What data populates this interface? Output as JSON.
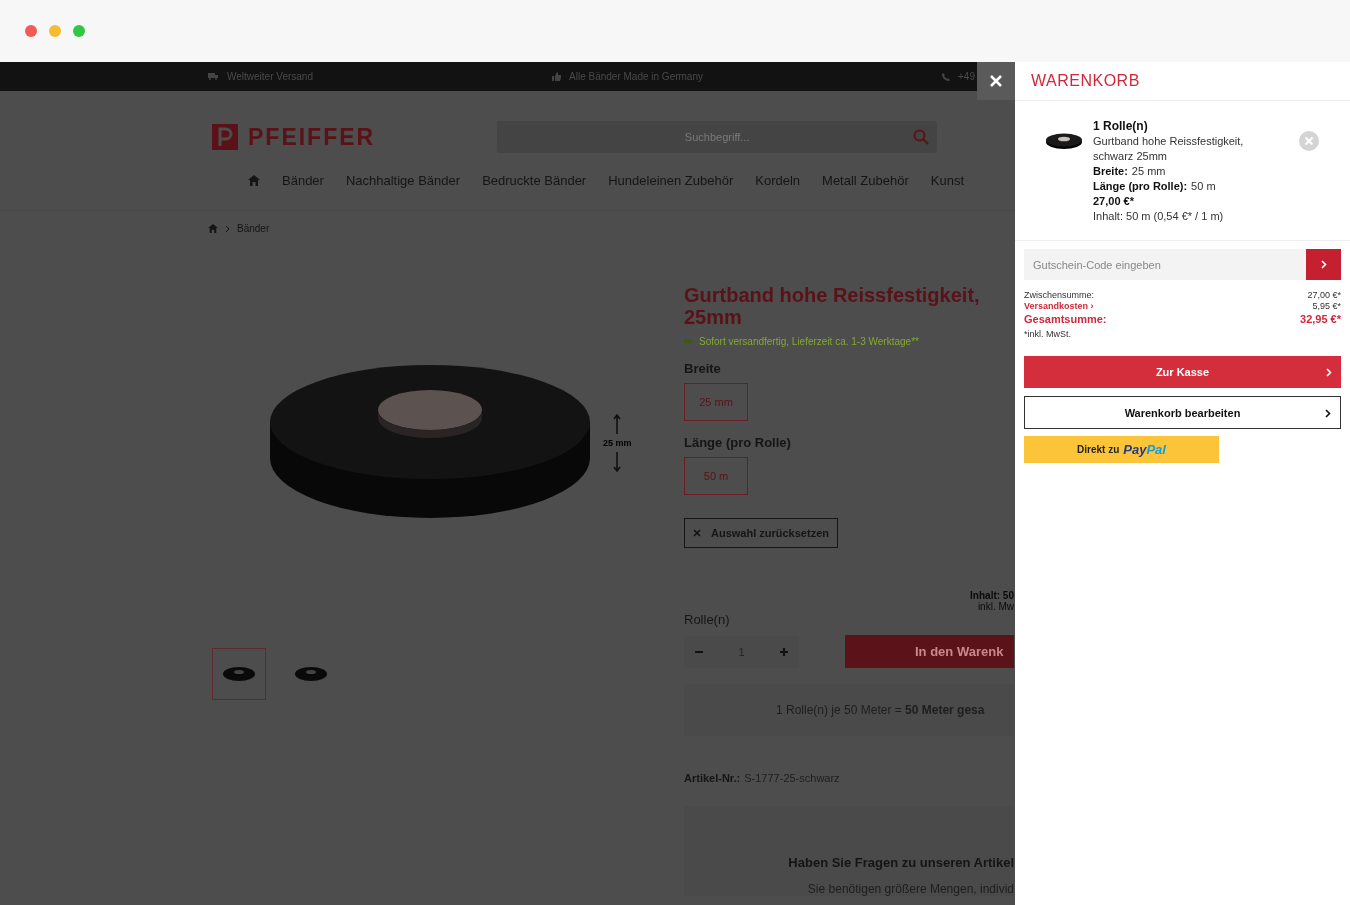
{
  "topbar": {
    "items": [
      {
        "kind": "truck",
        "text": "Weltweiter Versand"
      },
      {
        "kind": "thumb",
        "text": "Alle Bänder Made in Germany"
      },
      {
        "kind": "phone",
        "text": "+49"
      }
    ]
  },
  "header": {
    "logo_text": "PFEIFFER",
    "search": {
      "placeholder": "Suchbegriff..."
    }
  },
  "nav": {
    "items": [
      "Bänder",
      "Nachhaltige Bänder",
      "Bedruckte Bänder",
      "Hundeleinen Zubehör",
      "Kordeln",
      "Metall Zubehör",
      "Kunst"
    ]
  },
  "breadcrumb": [
    "Bänder"
  ],
  "product": {
    "title_lines": [
      "Gurtband hohe Reissfestigkeit,",
      "25mm"
    ],
    "availability": "Sofort versandfertig, Lieferzeit ca. 1-3 Werktage**",
    "image_dimension": "25 mm",
    "thumbnails": [
      {
        "selected": true
      },
      {
        "selected": false
      }
    ],
    "options": [
      {
        "label": "Breite",
        "values": [
          {
            "text": "25 mm",
            "selected": true
          }
        ]
      },
      {
        "label": "Länge (pro Rolle)",
        "values": [
          {
            "text": "50 m",
            "selected": true
          }
        ]
      }
    ],
    "reset_button": "Auswahl zurücksetzen",
    "content_note": "Inhalt: 50",
    "tax_note": "inkl. Mw",
    "quantity_label": "Rolle(n)",
    "quantity": "1",
    "add_to_cart": "In den Warenk",
    "summary": "1 Rolle(n) je 50 Meter = **50 Meter gesa**",
    "article_label": "Artikel-Nr.:",
    "article_number": "S-1777-25-schwarz",
    "questions_title": "Haben Sie Fragen zu unseren Artikel",
    "questions_text": "Sie benötigen größere Mengen, individ"
  },
  "cart": {
    "title": "WARENKORB",
    "items": [
      {
        "quantity": "1 Rolle(n)",
        "name": "Gurtband hohe Reissfestigkeit, schwarz 25mm",
        "properties": [
          {
            "label": "Breite:",
            "value": "25 mm"
          },
          {
            "label": "Länge (pro Rolle):",
            "value": "50 m"
          }
        ],
        "price": "27,00 €*",
        "content": "Inhalt: 50 m (0,54 €* / 1 m)"
      }
    ],
    "voucher": {
      "placeholder": "Gutschein-Code eingeben"
    },
    "totals": [
      {
        "kind": "normal",
        "label": "Zwischensumme:",
        "value": "27,00 €*"
      },
      {
        "kind": "link",
        "label": "Versandkosten ›",
        "value": "5,95 €*"
      },
      {
        "kind": "grand",
        "label": "Gesamtsumme:",
        "value": "32,95 €*"
      }
    ],
    "tax_note": "*inkl. MwSt.",
    "checkout_button": "Zur Kasse",
    "edit_button": "Warenkorb bearbeiten",
    "paypal": {
      "label": "Direkt zu",
      "brand": [
        "Pay",
        "Pal"
      ]
    }
  }
}
